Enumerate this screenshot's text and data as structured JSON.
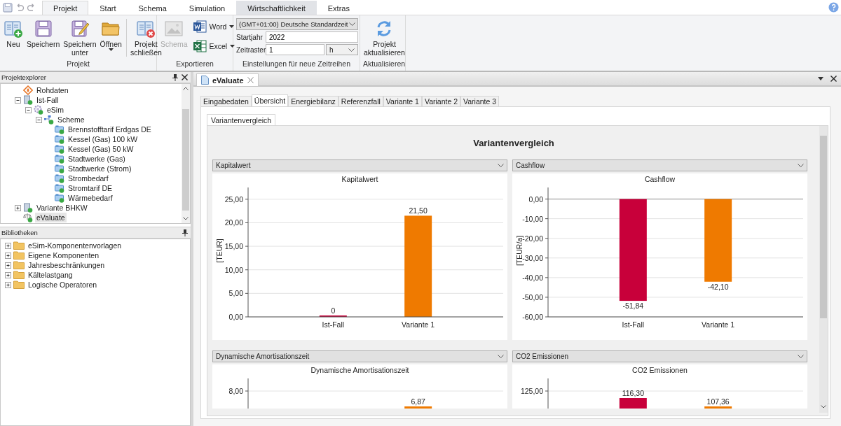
{
  "ribbon_tabs": [
    {
      "label": "Projekt",
      "selected": true,
      "contextual": false
    },
    {
      "label": "Start",
      "selected": false,
      "contextual": false
    },
    {
      "label": "Schema",
      "selected": false,
      "contextual": false
    },
    {
      "label": "Simulation",
      "selected": false,
      "contextual": false
    },
    {
      "label": "Wirtschaftlichkeit",
      "selected": false,
      "contextual": true
    },
    {
      "label": "Extras",
      "selected": false,
      "contextual": false
    }
  ],
  "ribbon": {
    "project_group": {
      "label": "Projekt",
      "buttons": [
        {
          "label": "Neu",
          "kind": "new",
          "dropdown": false,
          "separator_before": false
        },
        {
          "label": "Speichern",
          "kind": "save",
          "dropdown": false,
          "separator_before": false
        },
        {
          "label": "Speichern unter",
          "kind": "save_as",
          "dropdown": false,
          "separator_before": false
        },
        {
          "label": "Öffnen",
          "kind": "open",
          "dropdown": true,
          "separator_before": false
        },
        {
          "label": "Projekt schließen",
          "kind": "close_project",
          "dropdown": false,
          "separator_before": true
        }
      ]
    },
    "export_group": {
      "label": "Exportieren",
      "large_buttons": [
        {
          "label": "Schema",
          "kind": "image",
          "disabled": true
        }
      ],
      "small_buttons": [
        {
          "label": "Word",
          "kind": "word",
          "dropdown": true
        },
        {
          "label": "Excel",
          "kind": "excel",
          "dropdown": true
        }
      ]
    },
    "settings_group": {
      "label": "Einstellungen für neue Zeitreihen",
      "timezone": {
        "value": "(GMT+01:00) Deutsche Standardzeit"
      },
      "start_year": {
        "label": "Startjahr",
        "value": "2022"
      },
      "time_grid": {
        "label": "Zeitraster",
        "value": "1",
        "unit": "h"
      }
    },
    "refresh_group": {
      "label": "Aktualisieren",
      "button": {
        "label": "Projekt aktualisieren",
        "kind": "refresh"
      }
    }
  },
  "explorer": {
    "title": "Projektexplorer",
    "items": [
      {
        "label": "Rohdaten",
        "kind": "raw",
        "selected": false
      },
      {
        "label": "Ist-Fall",
        "kind": "case",
        "expanded": true,
        "selected": false,
        "children": [
          {
            "label": "eSim",
            "kind": "esim",
            "expanded": true,
            "selected": false,
            "children": [
              {
                "label": "Scheme",
                "kind": "scheme",
                "expanded": true,
                "selected": false,
                "children": [
                  {
                    "label": "Brennstofftarif Erdgas DE",
                    "kind": "component",
                    "selected": false
                  },
                  {
                    "label": "Kessel (Gas) 100 kW",
                    "kind": "component",
                    "selected": false
                  },
                  {
                    "label": "Kessel (Gas) 50 kW",
                    "kind": "component",
                    "selected": false
                  },
                  {
                    "label": "Stadtwerke (Gas)",
                    "kind": "component",
                    "selected": false
                  },
                  {
                    "label": "Stadtwerke (Strom)",
                    "kind": "component",
                    "selected": false
                  },
                  {
                    "label": "Strombedarf",
                    "kind": "component",
                    "selected": false
                  },
                  {
                    "label": "Stromtarif DE",
                    "kind": "component",
                    "selected": false
                  },
                  {
                    "label": "Wärmebedarf",
                    "kind": "component",
                    "selected": false
                  }
                ]
              }
            ]
          }
        ]
      },
      {
        "label": "Variante BHKW",
        "kind": "case",
        "expanded": false,
        "selected": false
      },
      {
        "label": "eValuate",
        "kind": "evaluate",
        "selected": true
      }
    ]
  },
  "libraries": {
    "title": "Bibliotheken",
    "items": [
      {
        "label": "eSim-Komponentenvorlagen",
        "expanded": false
      },
      {
        "label": "Eigene Komponenten",
        "expanded": false
      },
      {
        "label": "Jahresbeschränkungen",
        "expanded": false
      },
      {
        "label": "Kältelastgang",
        "expanded": false
      },
      {
        "label": "Logische Operatoren",
        "expanded": false
      }
    ]
  },
  "document_tabs": [
    {
      "label": "eValuate",
      "selected": true
    }
  ],
  "tabs": [
    {
      "label": "Eingabedaten",
      "selected": false
    },
    {
      "label": "Übersicht",
      "selected": true
    },
    {
      "label": "Energiebilanz",
      "selected": false
    },
    {
      "label": "Referenzfall",
      "selected": false
    },
    {
      "label": "Variante 1",
      "selected": false
    },
    {
      "label": "Variante 2",
      "selected": false
    },
    {
      "label": "Variante 3",
      "selected": false
    }
  ],
  "subtabs": [
    {
      "label": "Variantenvergleich",
      "selected": true
    }
  ],
  "overview": {
    "title": "Variantenvergleich",
    "panels": [
      {
        "selector": "Kapitalwert",
        "chart_data": {
          "type": "bar",
          "title": "Kapitalwert",
          "ylabel": "[TEUR]",
          "categories": [
            "Ist-Fall",
            "Variante 1"
          ],
          "series": [
            {
              "color": "#c8003a",
              "values": [
                0,
                null
              ]
            },
            {
              "color": "#ef7a00",
              "values": [
                null,
                21.5
              ]
            }
          ],
          "grid": true,
          "ylim": [
            0,
            27.5
          ],
          "yticks": [
            {
              "value": 0,
              "label": "0,00"
            },
            {
              "value": 5,
              "label": "5,00"
            },
            {
              "value": 10,
              "label": "10,00"
            },
            {
              "value": 15,
              "label": "15,00"
            },
            {
              "value": 20,
              "label": "20,00"
            },
            {
              "value": 25,
              "label": "25,00"
            }
          ],
          "value_labels": [
            "0",
            "21,50"
          ]
        }
      },
      {
        "selector": "Cashflow",
        "chart_data": {
          "type": "bar",
          "title": "Cashflow",
          "ylabel": "[TEUR/a]",
          "categories": [
            "Ist-Fall",
            "Variante 1"
          ],
          "series": [
            {
              "color": "#c8003a",
              "values": [
                -51.84,
                null
              ]
            },
            {
              "color": "#ef7a00",
              "values": [
                null,
                -42.1
              ]
            }
          ],
          "grid": true,
          "ylim": [
            -60,
            5.9
          ],
          "yticks": [
            {
              "value": 0,
              "label": "0,00"
            },
            {
              "value": -10,
              "label": "-10,00"
            },
            {
              "value": -20,
              "label": "-20,00"
            },
            {
              "value": -30,
              "label": "-30,00"
            },
            {
              "value": -40,
              "label": "-40,00"
            },
            {
              "value": -50,
              "label": "-50,00"
            },
            {
              "value": -60,
              "label": "-60,00"
            }
          ],
          "value_labels": [
            "-51,84",
            "-42,10"
          ]
        }
      },
      {
        "selector": "Dynamische Amortisationszeit",
        "preview": {
          "title": "Dynamische Amortisationszeit",
          "tick_label": "8,00",
          "bars": [
            {
              "kind": "none"
            },
            {
              "kind": "short",
              "label": "6,87",
              "color": "#ef7a00"
            }
          ]
        }
      },
      {
        "selector": "CO2 Emissionen",
        "preview": {
          "title": "CO2 Emissionen",
          "tick_label": "125,00",
          "bars": [
            {
              "kind": "tall",
              "label": "116,30",
              "color": "#c8003a"
            },
            {
              "kind": "short",
              "label": "107,36",
              "color": "#ef7a00"
            }
          ]
        }
      }
    ]
  }
}
